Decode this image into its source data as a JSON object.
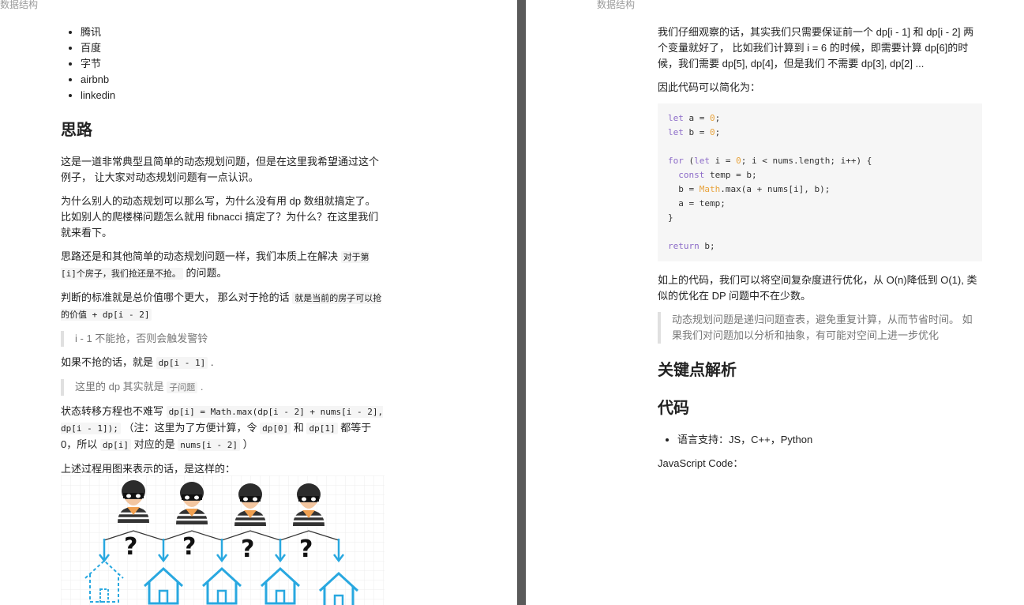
{
  "left_page": {
    "header": "数据结构",
    "companies": [
      "腾讯",
      "百度",
      "字节",
      "airbnb",
      "linkedin"
    ],
    "h_silu": "思路",
    "p1": "这是一道非常典型且简单的动态规划问题，但是在这里我希望通过这个例子， 让大家对动态规划问题有一点认识。",
    "p2": "为什么别人的动态规划可以那么写，为什么没有用 dp 数组就搞定了。比如别人的爬楼梯问题怎么就用 fibnacci 搞定了？为什么？在这里我们就来看下。",
    "p3_a": "思路还是和其他简单的动态规划问题一样，我们本质上在解决 ",
    "p3_code": "对于第[i]个房子，我们抢还是不抢。",
    "p3_b": " 的问题。",
    "p4_a": "判断的标准就是总价值哪个更大， 那么对于抢的话 ",
    "p4_code": "就是当前的房子可以抢的价值 + dp[i - 2]",
    "q1": "i - 1 不能抢，否则会触发警铃",
    "p5_a": "如果不抢的话，就是 ",
    "p5_code": "dp[i - 1]",
    "p5_b": " .",
    "q2_a": "这里的 dp 其实就是 ",
    "q2_code": "子问题",
    "q2_b": " .",
    "p6_a": "状态转移方程也不难写 ",
    "p6_code1": "dp[i] = Math.max(dp[i - 2] + nums[i - 2], dp[i - 1]);",
    "p6_b": " （注：这里为了方便计算，令 ",
    "p6_code2": "dp[0]",
    "p6_c": " 和 ",
    "p6_code3": "dp[1]",
    "p6_d": " 都等于 0，所以 ",
    "p6_code4": "dp[i]",
    "p6_e": " 对应的是 ",
    "p6_code5": "nums[i - 2]",
    "p6_f": " ）",
    "p7": "上述过程用图来表示的话，是这样的："
  },
  "right_page": {
    "header": "数据结构",
    "p1": "我们仔细观察的话，其实我们只需要保证前一个 dp[i - 1] 和 dp[i - 2] 两个变量就好了， 比如我们计算到 i = 6 的时候，即需要计算 dp[6]的时候，我们需要 dp[5], dp[4]，但是我们 不需要 dp[3], dp[2] ...",
    "p2": "因此代码可以简化为：",
    "p3": "如上的代码，我们可以将空间复杂度进行优化，从 O(n)降低到 O(1), 类似的优化在 DP 问题中不在少数。",
    "quote": "动态规划问题是递归问题查表，避免重复计算，从而节省时间。 如果我们对问题加以分析和抽象，有可能对空间上进一步优化",
    "h_key": "关键点解析",
    "h_code": "代码",
    "lang_item": "语言支持：JS，C++，Python",
    "js_label": "JavaScript Code："
  },
  "colors": {
    "accent_blue": "#29a8e0",
    "code_bg": "#f6f6f6",
    "keyword": "#8c6bc8",
    "number": "#e8a33d"
  },
  "icons": {
    "robber": "robber-icon",
    "question": "question-mark-icon",
    "house": "house-icon",
    "arrow": "arrow-down-icon"
  }
}
